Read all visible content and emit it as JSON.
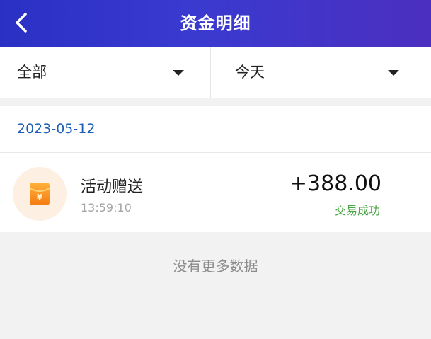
{
  "header": {
    "title": "资金明细",
    "back_icon": "chevron-left-icon",
    "gradient": [
      "#2b30c4",
      "#4b2fc0"
    ]
  },
  "filters": {
    "category": {
      "label": "全部",
      "icon": "caret-down-icon"
    },
    "period": {
      "label": "今天",
      "icon": "caret-down-icon"
    }
  },
  "groups": [
    {
      "date": "2023-05-12",
      "records": [
        {
          "icon": "red-envelope-yuan-icon",
          "title": "活动赠送",
          "time": "13:59:10",
          "amount": "+388.00",
          "status": "交易成功",
          "status_color": "#4aa645"
        }
      ]
    }
  ],
  "footer": {
    "no_more_text": "没有更多数据"
  }
}
